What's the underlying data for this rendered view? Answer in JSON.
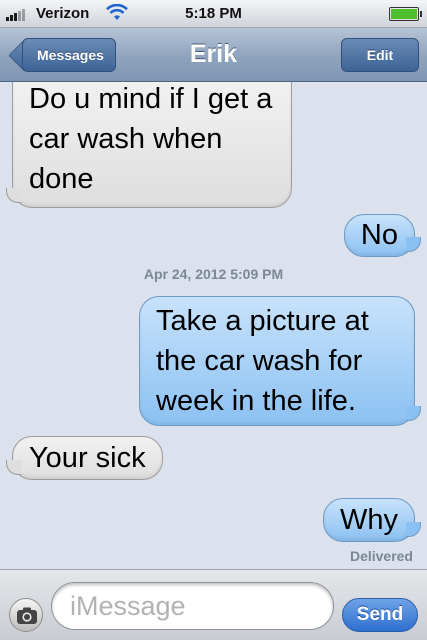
{
  "status_bar": {
    "carrier": "Verizon",
    "time": "5:18 PM",
    "battery_level": 1.0,
    "signal_icon": "signal-bars-icon",
    "wifi_icon": "wifi-icon"
  },
  "nav": {
    "back_label": "Messages",
    "title": "Erik",
    "edit_label": "Edit"
  },
  "thread": {
    "messages": [
      {
        "direction": "incoming",
        "text": "Do u mind if I get a car wash when done"
      },
      {
        "direction": "outgoing",
        "text": "No"
      },
      {
        "direction": "outgoing",
        "text": "Take a picture at the car wash for week in the life."
      },
      {
        "direction": "incoming",
        "text": "Your sick"
      },
      {
        "direction": "outgoing",
        "text": "Why"
      }
    ],
    "timestamp": "Apr 24, 2012 5:09 PM",
    "delivered_label": "Delivered"
  },
  "compose": {
    "placeholder": "iMessage",
    "value": "",
    "send_label": "Send",
    "camera_icon": "camera-icon"
  },
  "colors": {
    "outgoing_bubble": "#8bc1f2",
    "incoming_bubble": "#dedede",
    "send_button": "#2e6fcf",
    "nav_bar": "#8ea3bd"
  }
}
